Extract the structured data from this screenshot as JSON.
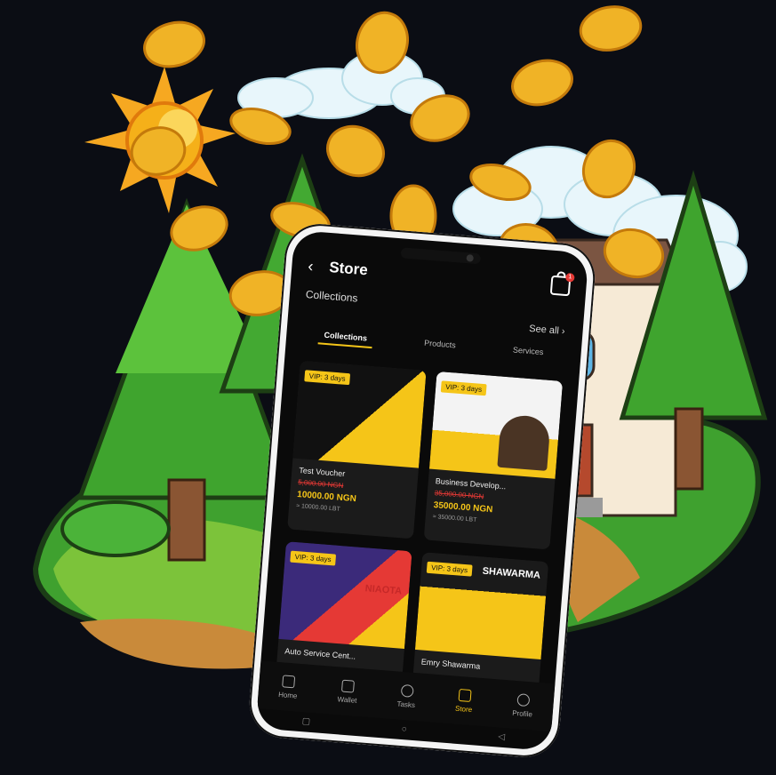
{
  "colors": {
    "background": "#0b0d14",
    "accent": "#f5c518",
    "sale": "#e53935"
  },
  "store": {
    "title": "Store",
    "section_label": "Collections",
    "see_all": "See all",
    "cart_badge": "1",
    "tabs": [
      {
        "label": "Collections",
        "active": true
      },
      {
        "label": "Products",
        "active": false
      },
      {
        "label": "Services",
        "active": false
      }
    ],
    "cards": [
      {
        "name": "Test Voucher",
        "vip": "VIP: 3 days",
        "old_price": "5,000.00 NGN",
        "price": "10000.00 NGN",
        "lbt": "≈ 10000.00 LBT",
        "thumb_text": "VIP"
      },
      {
        "name": "Business Develop...",
        "vip": "VIP: 3 days",
        "old_price": "35,000.00 NGN",
        "price": "35000.00 NGN",
        "lbt": "≈ 35000.00 LBT",
        "thumb_text": ""
      },
      {
        "name": "Auto Service Cent...",
        "vip": "VIP: 3 days",
        "old_price": "",
        "price": "",
        "lbt": "",
        "thumb_text": "NIAOTA"
      },
      {
        "name": "Emry Shawarma",
        "vip": "VIP: 3 days",
        "old_price": "",
        "price": "",
        "lbt": "",
        "thumb_text": "SHAWARMA"
      }
    ],
    "nav": [
      {
        "label": "Home",
        "icon": "home-icon"
      },
      {
        "label": "Wallet",
        "icon": "wallet-icon"
      },
      {
        "label": "Tasks",
        "icon": "tasks-icon"
      },
      {
        "label": "Store",
        "icon": "store-icon",
        "active": true
      },
      {
        "label": "Profile",
        "icon": "profile-icon"
      }
    ]
  }
}
